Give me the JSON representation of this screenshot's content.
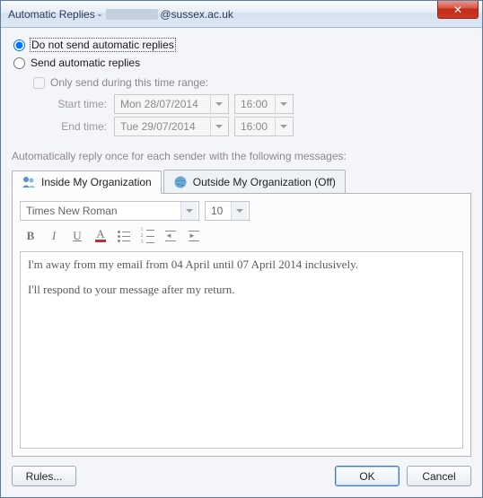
{
  "titlebar": {
    "prefix": "Automatic Replies - ",
    "suffix": "@sussex.ac.uk",
    "close_icon": "✕"
  },
  "options": {
    "do_not_send": "Do not send automatic replies",
    "send": "Send automatic replies",
    "only_send_range": "Only send during this time range:",
    "start_label": "Start time:",
    "end_label": "End time:",
    "start_date": "Mon 28/07/2014",
    "start_hour": "16:00",
    "end_date": "Tue 29/07/2014",
    "end_hour": "16:00"
  },
  "section_label": "Automatically reply once for each sender with the following messages:",
  "tabs": {
    "inside": "Inside My Organization",
    "outside": "Outside My Organization (Off)"
  },
  "toolbar": {
    "font_name": "Times New Roman",
    "font_size": "10"
  },
  "editor": {
    "p1": "I'm away from my email from 04 April until 07 April 2014 inclusively.",
    "p2": "I'll respond to your message after my return."
  },
  "footer": {
    "rules": "Rules...",
    "ok": "OK",
    "cancel": "Cancel"
  }
}
